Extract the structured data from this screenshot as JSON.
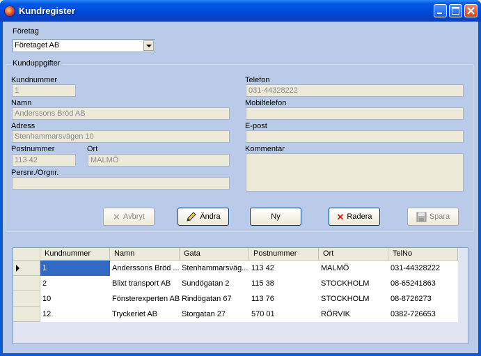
{
  "window": {
    "title": "Kundregister"
  },
  "company": {
    "label": "Företag",
    "selected": "Företaget AB"
  },
  "customer_details": {
    "legend": "Kunduppgifter",
    "fields": {
      "kundnummer": {
        "label": "Kundnummer",
        "value": "1"
      },
      "namn": {
        "label": "Namn",
        "value": "Anderssons Bröd AB"
      },
      "adress": {
        "label": "Adress",
        "value": "Stenhammarsvägen 10"
      },
      "postnummer": {
        "label": "Postnummer",
        "value": "113 42"
      },
      "ort": {
        "label": "Ort",
        "value": "MALMÖ"
      },
      "persnr": {
        "label": "Persnr./Orgnr.",
        "value": ""
      },
      "telefon": {
        "label": "Telefon",
        "value": "031-44328222"
      },
      "mobiltelefon": {
        "label": "Mobiltelefon",
        "value": ""
      },
      "epost": {
        "label": "E-post",
        "value": ""
      },
      "kommentar": {
        "label": "Kommentar",
        "value": ""
      }
    }
  },
  "buttons": {
    "avbryt": {
      "label": "Avbryt",
      "icon": "x-icon",
      "enabled": false
    },
    "andra": {
      "label": "Ändra",
      "icon": "pencil-icon",
      "enabled": true
    },
    "ny": {
      "label": "Ny",
      "enabled": true
    },
    "radera": {
      "label": "Radera",
      "icon": "x-icon",
      "enabled": true
    },
    "spara": {
      "label": "Spara",
      "icon": "floppy-icon",
      "enabled": false
    }
  },
  "grid": {
    "columns": [
      "Kundnummer",
      "Namn",
      "Gata",
      "Postnummer",
      "Ort",
      "TelNo"
    ],
    "rows": [
      [
        "1",
        "Anderssons Bröd ...",
        "Stenhammarsväg...",
        "113 42",
        "MALMÖ",
        "031-44328222"
      ],
      [
        "2",
        "Blixt transport AB",
        "Sundögatan 2",
        "115 38",
        "STOCKHOLM",
        "08-65241863"
      ],
      [
        "10",
        "Fönsterexperten AB",
        "Rindögatan 67",
        "113 76",
        "STOCKHOLM",
        "08-8726273"
      ],
      [
        "12",
        "Tryckeriet AB",
        "Storgatan 27",
        "570 01",
        "RÖRVIK",
        "0382-726653"
      ]
    ]
  },
  "colors": {
    "titlebar": "#0058e6",
    "client": "#b9cbe8",
    "selection": "#316ac5"
  }
}
